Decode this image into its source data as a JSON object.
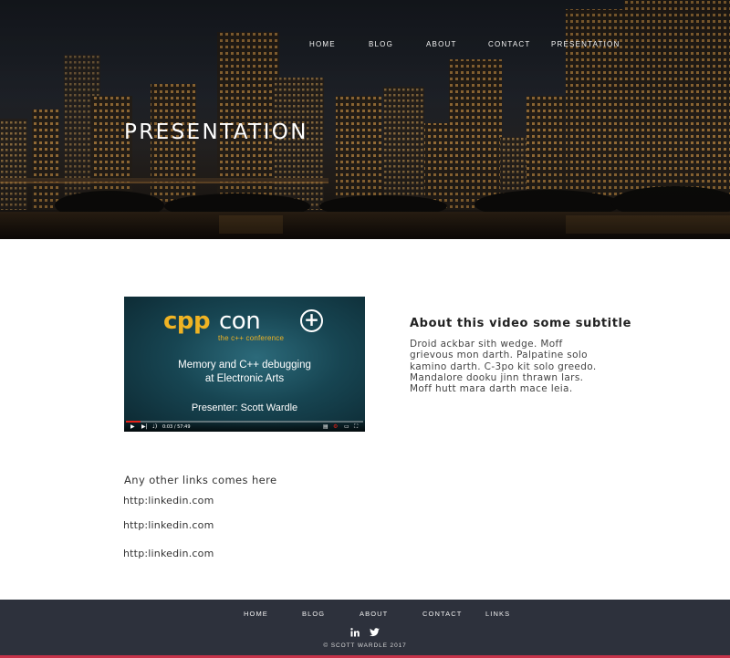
{
  "nav": {
    "items": [
      {
        "label": "HOME"
      },
      {
        "label": "BLOG"
      },
      {
        "label": "ABOUT"
      },
      {
        "label": "CONTACT"
      },
      {
        "label": "PRESENTATION"
      }
    ]
  },
  "hero": {
    "title": "PRESENTATION"
  },
  "video": {
    "logo_cpp": "cpp",
    "logo_con": "con",
    "logo_subtitle": "the c++ conference",
    "talk_title_line1": "Memory and C++ debugging",
    "talk_title_line2": "at Electronic Arts",
    "presenter": "Presenter: Scott Wardle",
    "time_display": "0:03 / 57:49",
    "progress_fraction": 0.06
  },
  "about": {
    "subtitle": "About this video some subtitle",
    "lines": [
      "Droid ackbar sith wedge. Moff",
      "grievous mon darth. Palpatine solo",
      "kamino darth. C-3po kit solo greedo.",
      "Mandalore dooku jinn thrawn lars.",
      "Moff hutt mara darth mace leia."
    ]
  },
  "links": {
    "heading": "Any other links comes here",
    "items": [
      {
        "label": "http:linkedin.com"
      },
      {
        "label": "http:linkedin.com"
      },
      {
        "label": "http:linkedin.com"
      }
    ]
  },
  "footer": {
    "nav": [
      {
        "label": "HOME"
      },
      {
        "label": "BLOG"
      },
      {
        "label": "ABOUT"
      },
      {
        "label": "CONTACT"
      },
      {
        "label": "LINKS"
      }
    ],
    "social_icons": [
      "linkedin-icon",
      "twitter-icon"
    ],
    "copyright": "© SCOTT WARDLE 2017"
  },
  "colors": {
    "footer_bg": "#2d313c",
    "accent": "#c8334a",
    "cppcon_yellow": "#f0b323",
    "video_teal": "#174552"
  }
}
